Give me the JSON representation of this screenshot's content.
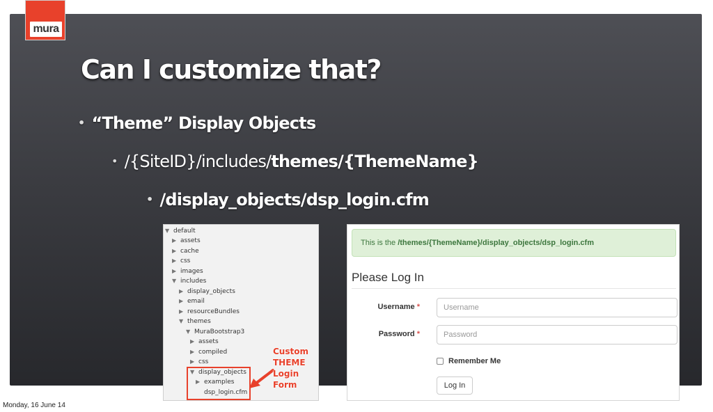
{
  "logo": {
    "text": "mura",
    "brand_color": "#e8412b"
  },
  "slide": {
    "title": "Can I customize that?",
    "bullets": {
      "b1": "“Theme” Display Objects",
      "b2_normal": "/{SiteID}/includes/",
      "b2_bold": "themes/{ThemeName}",
      "b3": "/display_objects/dsp_login.cfm"
    },
    "bullet_glyph": "•"
  },
  "file_tree": {
    "items": [
      {
        "label": "default",
        "state": "expanded"
      },
      {
        "label": "assets",
        "state": "collapsed"
      },
      {
        "label": "cache",
        "state": "collapsed"
      },
      {
        "label": "css",
        "state": "collapsed"
      },
      {
        "label": "images",
        "state": "collapsed"
      },
      {
        "label": "includes",
        "state": "expanded"
      },
      {
        "label": "display_objects",
        "state": "collapsed"
      },
      {
        "label": "email",
        "state": "collapsed"
      },
      {
        "label": "resourceBundles",
        "state": "collapsed"
      },
      {
        "label": "themes",
        "state": "expanded"
      },
      {
        "label": "MuraBootstrap3",
        "state": "expanded"
      },
      {
        "label": "assets",
        "state": "collapsed"
      },
      {
        "label": "compiled",
        "state": "collapsed"
      },
      {
        "label": "css",
        "state": "collapsed"
      },
      {
        "label": "display_objects",
        "state": "expanded"
      },
      {
        "label": "examples",
        "state": "collapsed"
      },
      {
        "label": "dsp_login.cfm",
        "state": "file"
      }
    ]
  },
  "annotation": {
    "lines": [
      "Custom",
      "THEME",
      "Login",
      "Form"
    ],
    "color": "#e8412b"
  },
  "login": {
    "alert_prefix": "This is the ",
    "alert_path": "/themes/{ThemeName}/display_objects/dsp_login.cfm",
    "heading": "Please Log In",
    "username_label": "Username",
    "username_placeholder": "Username",
    "password_label": "Password",
    "password_placeholder": "Password",
    "required_mark": "*",
    "remember_label": "Remember Me",
    "button_label": "Log In"
  },
  "footer": {
    "date": "Monday, 16 June 14"
  }
}
